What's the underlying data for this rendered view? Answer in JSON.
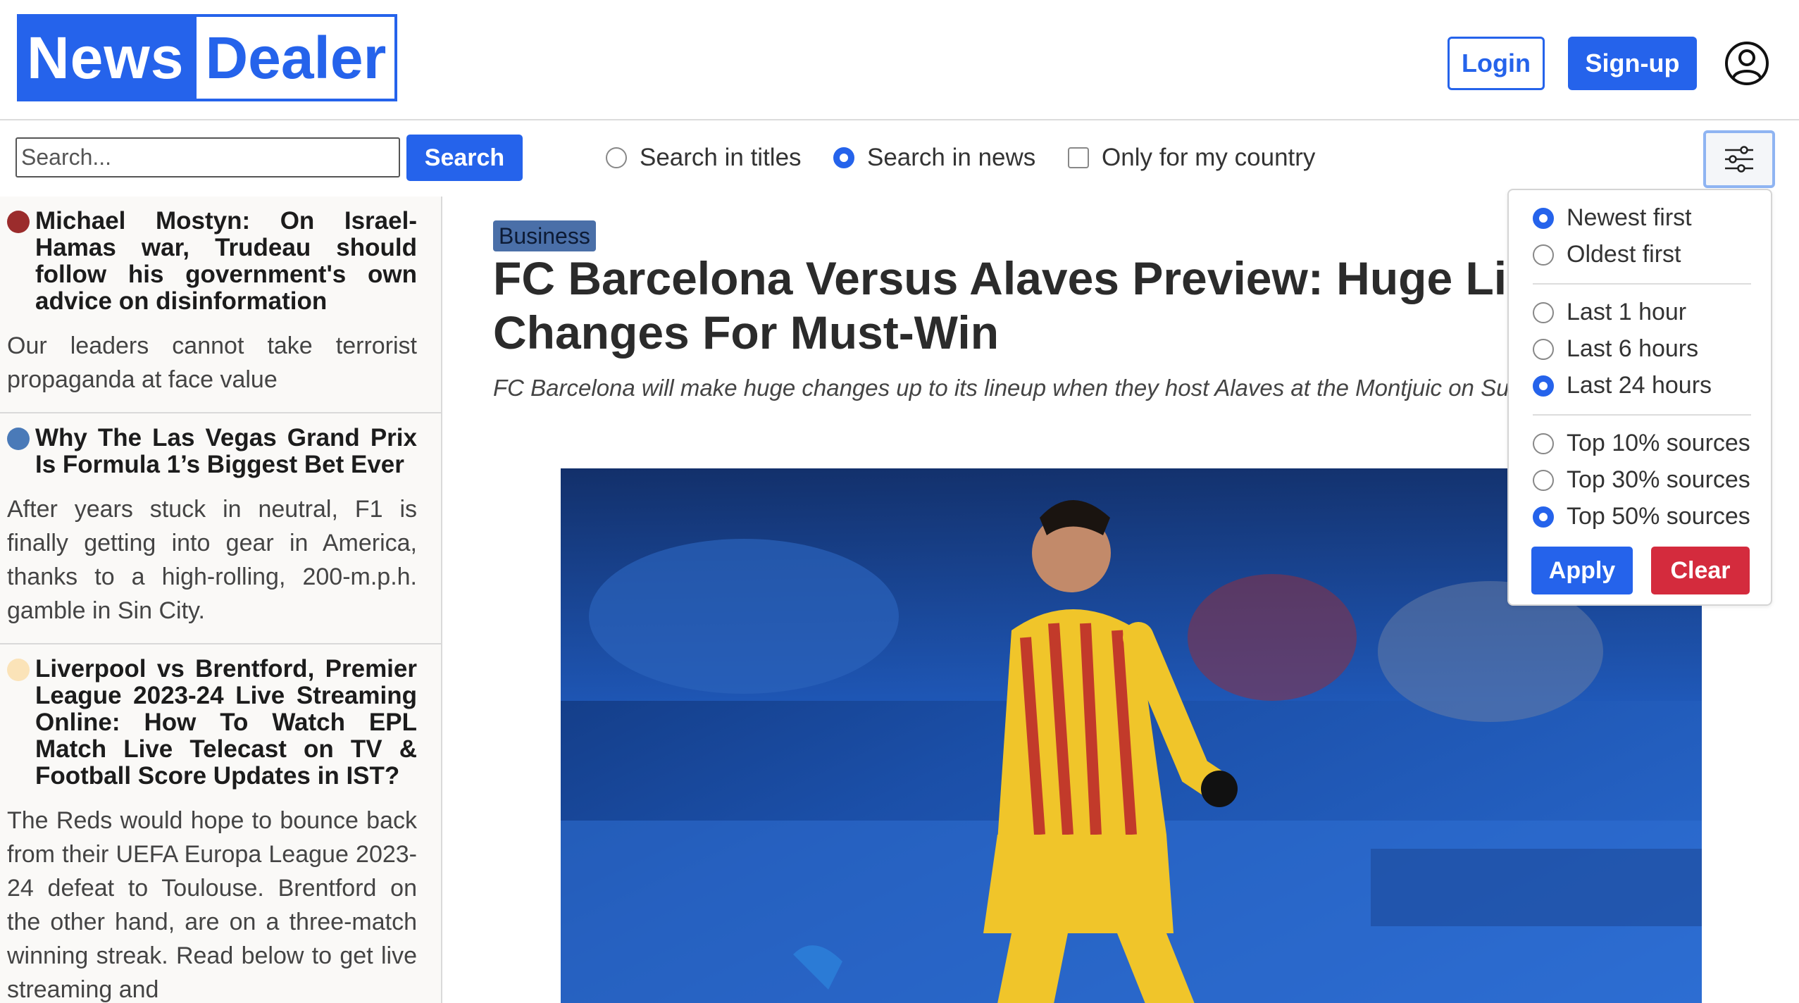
{
  "brand": {
    "part1": "News",
    "part2": "Dealer"
  },
  "auth": {
    "login_label": "Login",
    "signup_label": "Sign-up"
  },
  "search": {
    "placeholder": "Search...",
    "button_label": "Search",
    "opt_titles": "Search in titles",
    "opt_news": "Search in news",
    "opt_country": "Only for my country"
  },
  "sidebar": {
    "items": [
      {
        "dot_color": "#9b2c2c",
        "title": "Michael Mostyn: On Israel-Hamas war, Trudeau should follow his government's own advice on disinformation",
        "desc": "Our leaders cannot take terrorist propaganda at face value"
      },
      {
        "dot_color": "#4a7ab8",
        "title": "Why The Las Vegas Grand Prix Is Formula 1’s Biggest Bet Ever",
        "desc": "After years stuck in neutral, F1 is finally getting into gear in America, thanks to a high-rolling, 200-m.p.h. gamble in Sin City."
      },
      {
        "dot_color": "#fbe3b8",
        "title": "Liverpool vs Brentford, Premier League 2023-24 Live Streaming Online: How To Watch EPL Match Live Telecast on TV & Football Score Updates in IST?",
        "desc": "The Reds would hope to bounce back from their UEFA Europa League 2023-24 defeat to Toulouse. Brentford on the other hand, are on a three-match winning streak. Read below to get live streaming and"
      }
    ]
  },
  "article": {
    "category": "Business",
    "headline": "FC Barcelona Versus Alaves Preview: Huge Lineup Changes For Must-Win",
    "subhead": "FC Barcelona will make huge changes up to its lineup when they host Alaves at the Montjuic on Sunday."
  },
  "filters": {
    "sort": [
      "Newest first",
      "Oldest first"
    ],
    "time": [
      "Last 1 hour",
      "Last 6 hours",
      "Last 24 hours"
    ],
    "sources": [
      "Top 10% sources",
      "Top 30% sources",
      "Top 50% sources"
    ],
    "apply_label": "Apply",
    "clear_label": "Clear"
  },
  "colors": {
    "accent": "#2563eb",
    "danger": "#d42b3d"
  }
}
